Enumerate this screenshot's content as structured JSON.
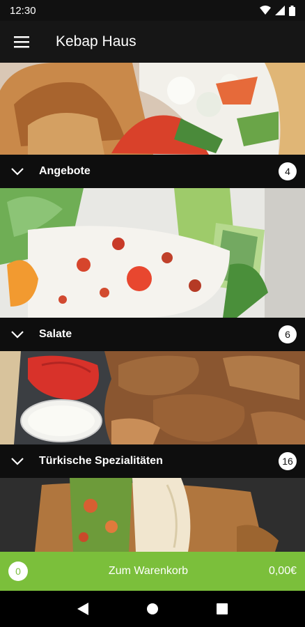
{
  "status_bar": {
    "time": "12:30"
  },
  "app_bar": {
    "title": "Kebap Haus"
  },
  "categories": [
    {
      "name": "Angebote",
      "count": "4"
    },
    {
      "name": "Salate",
      "count": "6"
    },
    {
      "name": "Türkische Spezialitäten",
      "count": "16"
    }
  ],
  "cart": {
    "item_count": "0",
    "label": "Zum Warenkorb",
    "total": "0,00€"
  },
  "colors": {
    "accent": "#7bbf3b",
    "bar": "#0e0e0e",
    "appbar": "#161616"
  }
}
